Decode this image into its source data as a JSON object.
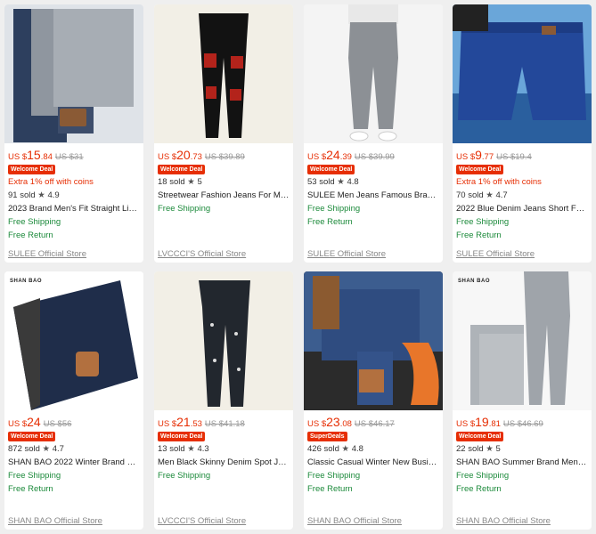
{
  "products": [
    {
      "currency": "US $",
      "price_main": "15",
      "price_dec": ".84",
      "orig": "US $31",
      "badge": "Welcome Deal",
      "coins": "Extra 1% off with coins",
      "sold": "91 sold",
      "rating": "4.9",
      "title": "2023 Brand Men's Fit Straight Ligh...",
      "ship": "Free Shipping",
      "ret": "Free Return",
      "store": "SULEE Official Store"
    },
    {
      "currency": "US $",
      "price_main": "20",
      "price_dec": ".73",
      "orig": "US $39.89",
      "badge": "Welcome Deal",
      "coins": "",
      "sold": "18 sold",
      "rating": "5",
      "title": "Streetwear Fashion Jeans For Men ...",
      "ship": "Free Shipping",
      "ret": "",
      "store": "LVCCCI'S Official Store"
    },
    {
      "currency": "US $",
      "price_main": "24",
      "price_dec": ".39",
      "orig": "US $39.99",
      "badge": "Welcome Deal",
      "coins": "",
      "sold": "53 sold",
      "rating": "4.8",
      "title": "SULEE Men Jeans Famous Brand R...",
      "ship": "Free Shipping",
      "ret": "Free Return",
      "store": "SULEE Official Store"
    },
    {
      "currency": "US $",
      "price_main": "9",
      "price_dec": ".77",
      "orig": "US $19.4",
      "badge": "Welcome Deal",
      "coins": "Extra 1% off with coins",
      "sold": "70 sold",
      "rating": "4.7",
      "title": "2022 Blue Denim Jeans Short For ...",
      "ship": "Free Shipping",
      "ret": "Free Return",
      "store": "SULEE Official Store"
    },
    {
      "currency": "US $",
      "price_main": "24",
      "price_dec": "",
      "orig": "US $56",
      "badge": "Welcome Deal",
      "coins": "",
      "sold": "872 sold",
      "rating": "4.7",
      "title": "SHAN BAO 2022 Winter Brand Fit S...",
      "ship": "Free Shipping",
      "ret": "Free Return",
      "store": "SHAN BAO Official Store",
      "logo": "SHAN BAO"
    },
    {
      "currency": "US $",
      "price_main": "21",
      "price_dec": ".53",
      "orig": "US $41.18",
      "badge": "Welcome Deal",
      "coins": "",
      "sold": "13 sold",
      "rating": "4.3",
      "title": "Men Black Skinny Denim Spot Jean...",
      "ship": "Free Shipping",
      "ret": "",
      "store": "LVCCCI'S Official Store"
    },
    {
      "currency": "US $",
      "price_main": "23",
      "price_dec": ".08",
      "orig": "US $46.17",
      "badge": "SuperDeals",
      "coins": "",
      "sold": "426 sold",
      "rating": "4.8",
      "title": "Classic Casual Winter New Busines...",
      "ship": "Free Shipping",
      "ret": "Free Return",
      "store": "SHAN BAO Official Store"
    },
    {
      "currency": "US $",
      "price_main": "19",
      "price_dec": ".81",
      "orig": "US $46.69",
      "badge": "Welcome Deal",
      "coins": "",
      "sold": "22 sold",
      "rating": "5",
      "title": "SHAN BAO Summer Brand Men's F...",
      "ship": "Free Shipping",
      "ret": "Free Return",
      "store": "SHAN BAO Official Store",
      "logo": "SHAN BAO"
    }
  ],
  "colors": {
    "price": "#e62e04",
    "shipping": "#1c8a3b",
    "star": "#555555"
  }
}
